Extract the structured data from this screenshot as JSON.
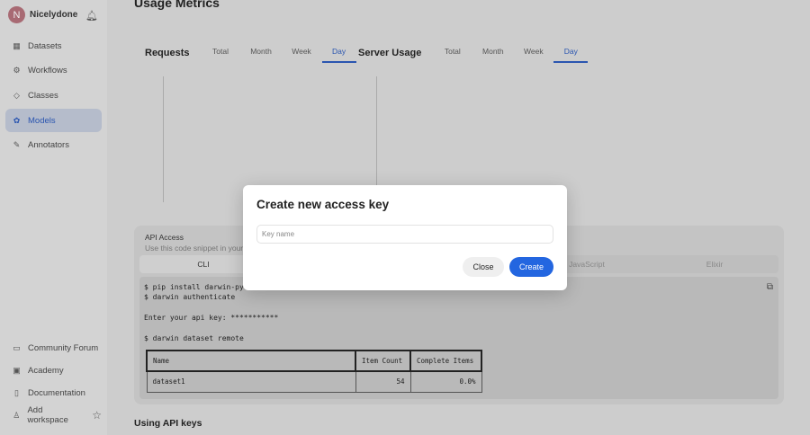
{
  "user": {
    "initial": "N",
    "name": "Nicelydone"
  },
  "sidebar": {
    "items": [
      {
        "label": "Datasets",
        "icon": "grid-icon"
      },
      {
        "label": "Workflows",
        "icon": "workflow-icon"
      },
      {
        "label": "Classes",
        "icon": "tag-icon"
      },
      {
        "label": "Models",
        "icon": "model-icon",
        "active": true
      },
      {
        "label": "Annotators",
        "icon": "pen-icon"
      }
    ],
    "bottom": [
      {
        "label": "Community Forum",
        "icon": "chat-icon"
      },
      {
        "label": "Academy",
        "icon": "play-icon"
      },
      {
        "label": "Documentation",
        "icon": "doc-icon"
      },
      {
        "label": "Add workspace",
        "icon": "user-add-icon"
      }
    ]
  },
  "page": {
    "title": "Usage Metrics",
    "section2": "Using API keys"
  },
  "requests": {
    "title": "Requests",
    "tabs": [
      "Total",
      "Month",
      "Week",
      "Day"
    ],
    "selected": "Day"
  },
  "server": {
    "title": "Server Usage",
    "tabs": [
      "Total",
      "Month",
      "Week",
      "Day"
    ],
    "selected": "Day"
  },
  "api": {
    "title": "API Access",
    "subtitle": "Use this code snippet in your p",
    "tabs": [
      "CLI",
      "",
      "",
      "JavaScript",
      "Elixir"
    ],
    "selected": "CLI",
    "code": [
      "$ pip install darwin-py",
      "$ darwin authenticate",
      "Enter your api key: ***********",
      "$ darwin dataset remote"
    ],
    "table": {
      "headers": [
        "Name",
        "Item Count",
        "Complete Items"
      ],
      "rows": [
        [
          "dataset1",
          "54",
          "0.0%"
        ]
      ]
    }
  },
  "modal": {
    "title": "Create new access key",
    "placeholder": "Key name",
    "close": "Close",
    "create": "Create"
  },
  "colors": {
    "accent": "#2366e0",
    "avatar": "#a86a73"
  }
}
